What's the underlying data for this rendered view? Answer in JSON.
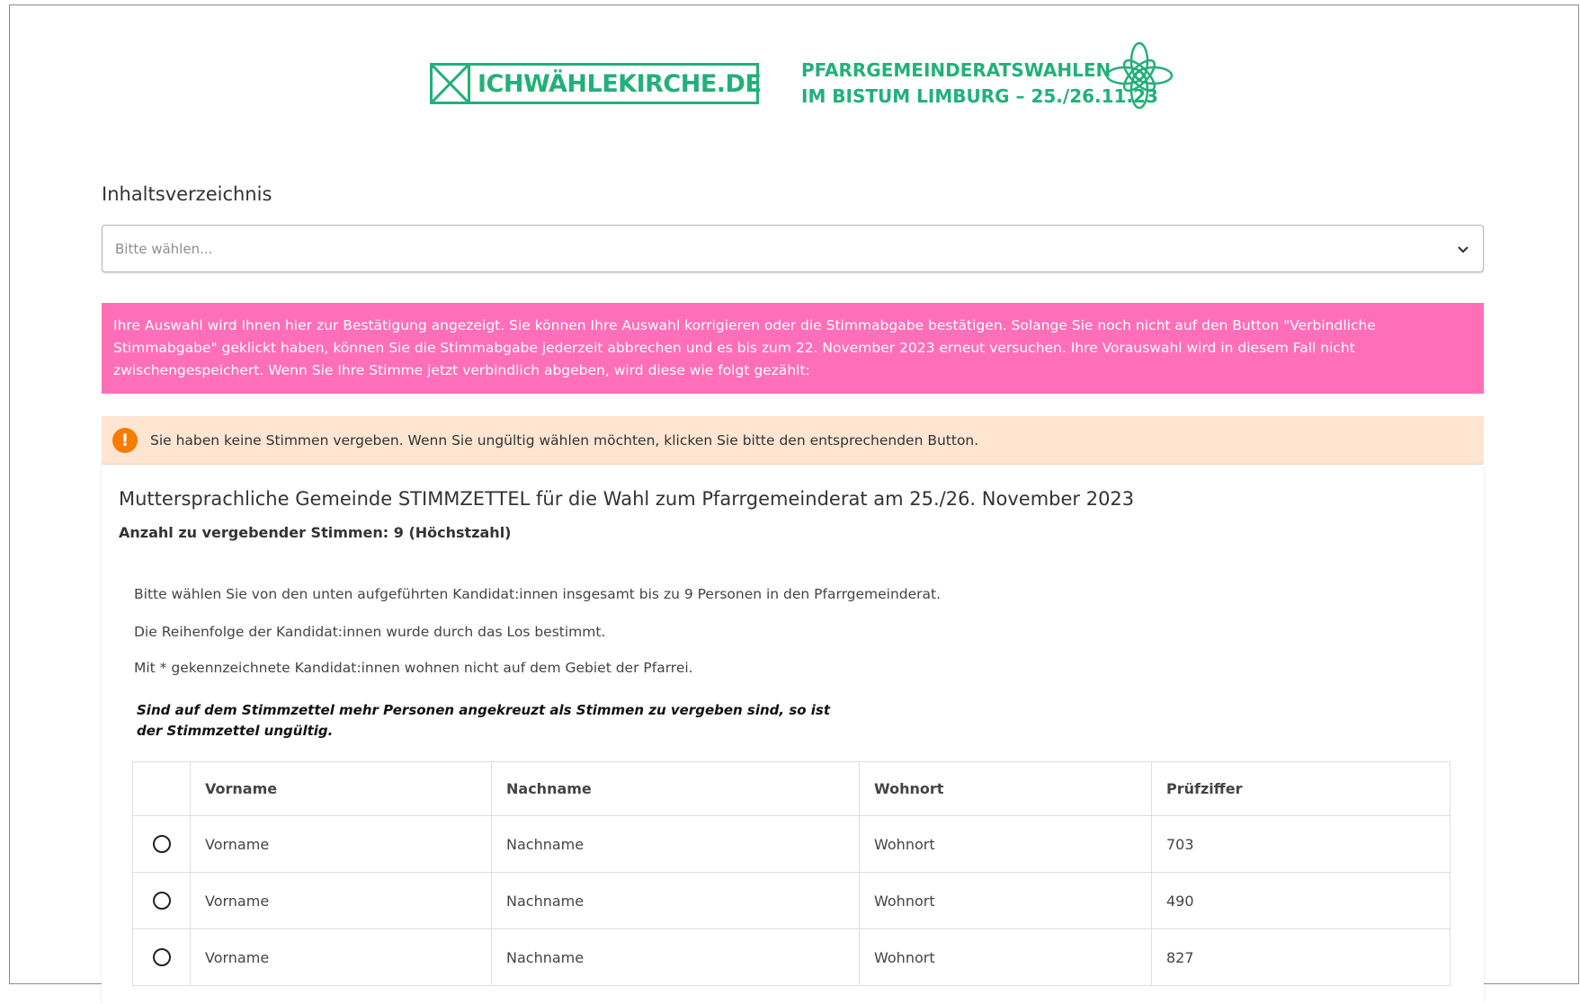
{
  "header": {
    "logo_text": "ICHWÄHLEKIRCHE.DE",
    "election_line1": "PFARRGEMEINDERATSWAHLEN",
    "election_line2": "IM BISTUM LIMBURG – 25./26.11.23",
    "brand_color": "#22b07a"
  },
  "toc": {
    "label": "Inhaltsverzeichnis",
    "select_placeholder": "Bitte wählen..."
  },
  "notice": {
    "text": "Ihre Auswahl wird Ihnen hier zur Bestätigung angezeigt. Sie können Ihre Auswahl korrigieren oder die Stimmabgabe bestätigen. Solange Sie noch nicht auf den Button \"Verbindliche Stimmabgabe\" geklickt haben, können Sie die Stimmabgabe jederzeit abbrechen und es bis zum 22. November 2023 erneut versuchen. Ihre Vorauswahl wird in diesem Fall nicht zwischengespeichert. Wenn Sie Ihre Stimme jetzt verbindlich abgeben, wird diese wie folgt gezählt:",
    "color": "#ff6eb9"
  },
  "warning": {
    "text": "Sie haben keine Stimmen vergeben. Wenn Sie ungültig wählen möchten, klicken Sie bitte den entsprechenden Button.",
    "icon": "exclamation-icon",
    "icon_glyph": "!"
  },
  "ballot": {
    "title": "Muttersprachliche Gemeinde STIMMZETTEL für die Wahl zum Pfarrgemeinderat am 25./26. November 2023",
    "votes_info": "Anzahl zu vergebender Stimmen: 9 (Höchstzahl)",
    "instruction1": "Bitte wählen Sie von den unten aufgeführten Kandidat:innen insgesamt bis zu 9 Personen in den Pfarrgemeinderat.",
    "instruction2": "Die Reihenfolge der Kandidat:innen wurde durch das Los bestimmt.",
    "instruction3": "Mit * gekennzeichnete Kandidat:innen wohnen nicht auf dem Gebiet der Pfarrei.",
    "invalid_note": "Sind auf dem Stimmzettel mehr Personen angekreuzt als Stimmen zu vergeben sind, so ist der Stimmzettel ungültig."
  },
  "table": {
    "headers": [
      "Vorname",
      "Nachname",
      "Wohnort",
      "Prüfziffer"
    ],
    "rows": [
      {
        "first": "Vorname",
        "last": "Nachname",
        "city": "Wohnort",
        "check": "703"
      },
      {
        "first": "Vorname",
        "last": "Nachname",
        "city": "Wohnort",
        "check": "490"
      },
      {
        "first": "Vorname",
        "last": "Nachname",
        "city": "Wohnort",
        "check": "827"
      }
    ]
  }
}
